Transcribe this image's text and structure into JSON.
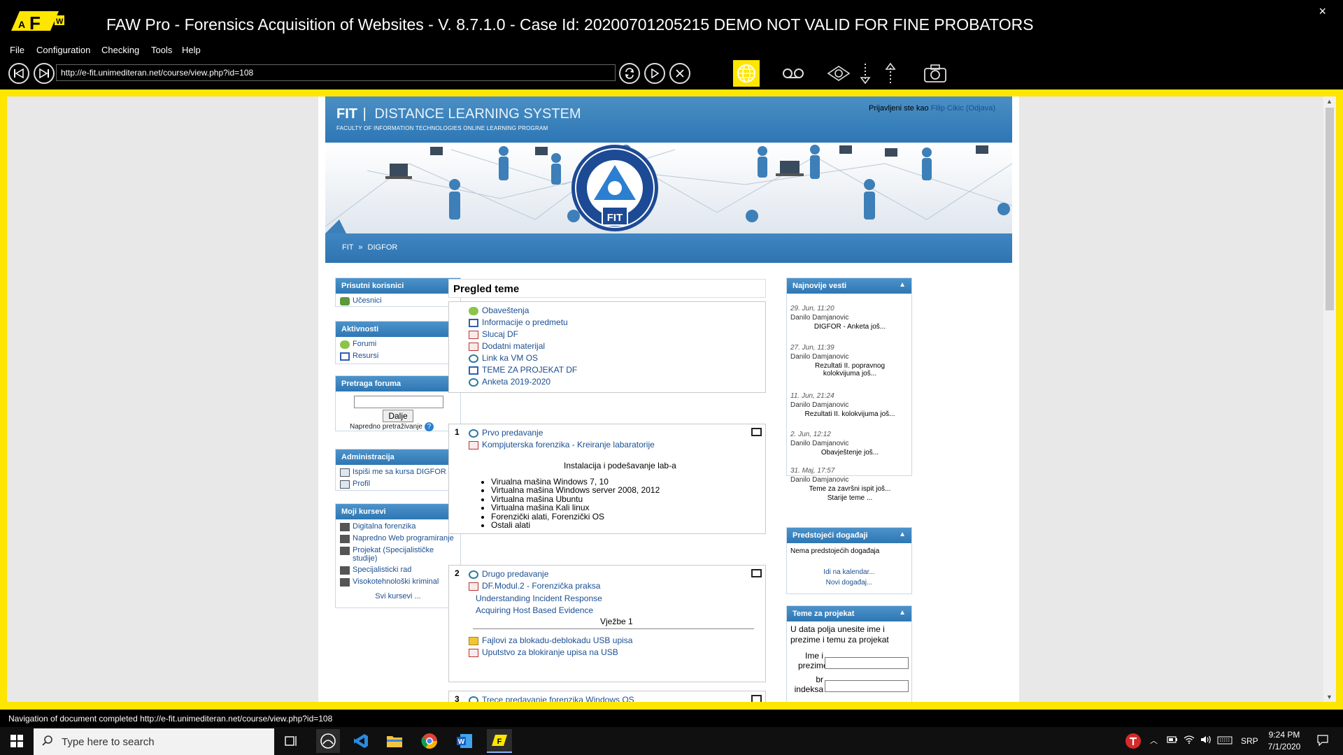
{
  "app": {
    "title": "FAW Pro - Forensics Acquisition of Websites - V. 8.7.1.0 - Case Id: 20200701205215 DEMO NOT VALID FOR FINE PROBATORS",
    "logo_text": "AFW",
    "close": "×"
  },
  "menu": [
    "File",
    "Configuration",
    "Checking",
    "Tools",
    "Help"
  ],
  "address": "http://e-fit.unimediteran.net/course/view.php?id=108",
  "site": {
    "header": {
      "title_bold": "FIT",
      "title_rest": "DISTANCE LEARNING SYSTEM",
      "subtitle": "FACULTY OF INFORMATION TECHNOLOGIES ONLINE LEARNING PROGRAM",
      "login_prefix": "Prijavljeni ste kao",
      "login_user": "Filip Cikic",
      "logout": "(Odjava)"
    },
    "seal_text": "FIT",
    "breadcrumb": {
      "root": "FIT",
      "sep": "»",
      "current": "DIGFOR"
    },
    "left": {
      "present": {
        "title": "Prisutni korisnici",
        "items": [
          "Učesnici"
        ]
      },
      "activities": {
        "title": "Aktivnosti",
        "items": [
          "Forumi",
          "Resursi"
        ]
      },
      "search": {
        "title": "Pretraga foruma",
        "button": "Dalje",
        "advanced": "Napredno pretraživanje"
      },
      "admin": {
        "title": "Administracija",
        "items": [
          "Ispiši me sa kursa DIGFOR",
          "Profil"
        ]
      },
      "courses": {
        "title": "Moji kursevi",
        "items": [
          "Digitalna forenzika",
          "Napredno Web programiranje",
          "Projekat (Specijalističke studije)",
          "Specijalisticki rad",
          "Visokotehnološki kriminal"
        ],
        "all": "Svi kursevi ..."
      }
    },
    "center": {
      "overview_title": "Pregled teme",
      "overview_items": [
        "Obaveštenja",
        "Informacije o predmetu",
        "Slucaj DF",
        "Dodatni materijal",
        "Link ka VM OS",
        "TEME ZA PROJEKAT DF",
        "Anketa 2019-2020"
      ],
      "s1": {
        "num": "1",
        "links": [
          "Prvo predavanje",
          "Kompjuterska forenzika - Kreiranje labaratorije"
        ],
        "heading": "Instalacija i podešavanje lab-a",
        "bullets": [
          "Virualna mašina Windows 7, 10",
          "Virtualna mašina Windows server 2008, 2012",
          "Virtualna mašina Ubuntu",
          "Virtualna mašina Kali linux",
          "Forenzički alati, Forenzički OS",
          "Ostali alati"
        ]
      },
      "s2": {
        "num": "2",
        "links": [
          "Drugo predavanje",
          "DF.Modul.2 - Forenzička praksa"
        ],
        "plain_links": [
          "Understanding Incident Response",
          "Acquiring Host Based Evidence"
        ],
        "heading": "Vježbe 1",
        "after": [
          "Fajlovi za blokadu-deblokadu USB upisa",
          "Uputstvo za blokiranje upisa na USB"
        ]
      },
      "s3": {
        "num": "3",
        "link": "Trece predavanje forenzika Windows OS"
      }
    },
    "right": {
      "news": {
        "title": "Najnovije vesti",
        "items": [
          {
            "date": "29. Jun, 11:20",
            "author": "Danilo Damjanovic",
            "text": "DIGFOR - Anketa još..."
          },
          {
            "date": "27. Jun, 11:39",
            "author": "Danilo Damjanovic",
            "text": "Rezultati II. popravnog kolokvijuma još..."
          },
          {
            "date": "11. Jun, 21:24",
            "author": "Danilo Damjanovic",
            "text": "Rezultati II. kolokvijuma još..."
          },
          {
            "date": "2. Jun, 12:12",
            "author": "Danilo Damjanovic",
            "text": "Obavještenje još..."
          },
          {
            "date": "31. Maj, 17:57",
            "author": "Danilo Damjanovic",
            "text": "Teme za završni ispit još..."
          }
        ],
        "older": "Starije teme ..."
      },
      "events": {
        "title": "Predstojeći događaji",
        "none": "Nema predstojećih događaja",
        "calendar": "Idi na kalendar...",
        "new": "Novi događaj..."
      },
      "project": {
        "title": "Teme za projekat",
        "intro": "U data polja unesite ime i prezime i temu za projekat",
        "label1a": "Ime i",
        "label1b": "prezime",
        "label2a": "br",
        "label2b": "indeksa"
      }
    }
  },
  "status": "Navigation of document completed http://e-fit.unimediteran.net/course/view.php?id=108",
  "taskbar": {
    "search_placeholder": "Type here to search",
    "lang": "SRP",
    "time": "9:24 PM",
    "date": "7/1/2020"
  },
  "colors": {
    "frame": "#ffe600",
    "blue": "#2f74b0",
    "link": "#1a4f92"
  }
}
